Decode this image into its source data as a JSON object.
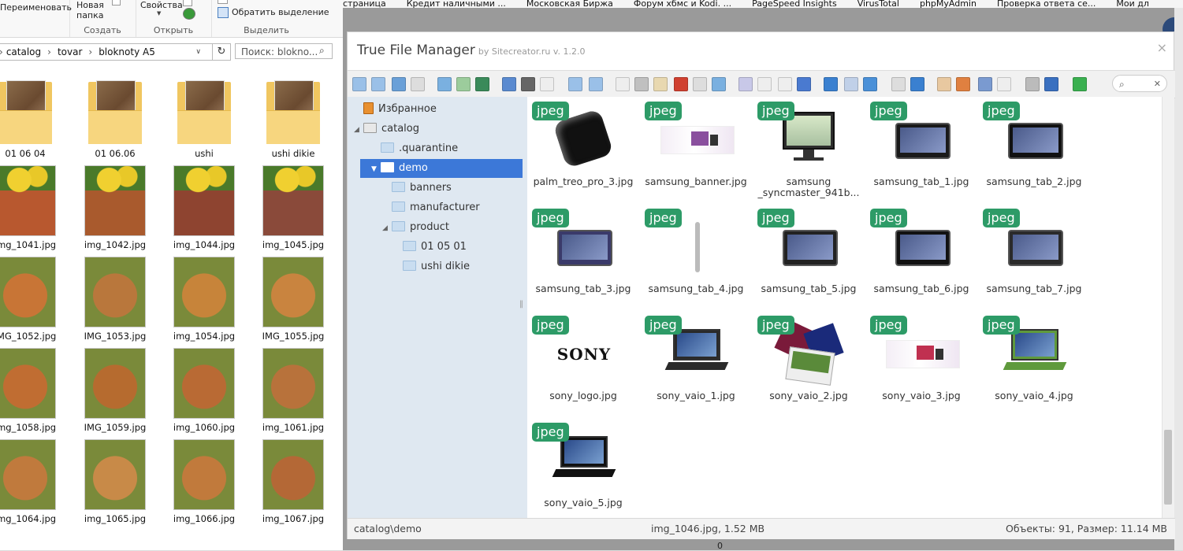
{
  "explorer": {
    "ribbon": {
      "rename": "Переименовать",
      "new_folder": "Новая папка",
      "group_create": "Создать",
      "properties": "Свойства",
      "group_open": "Открыть",
      "invert_selection": "Обратить выделение",
      "group_select": "Выделить"
    },
    "path": [
      "catalog",
      "tovar",
      "bloknoty A5"
    ],
    "search_placeholder": "Поиск: blokno...",
    "folders": [
      {
        "name": "01 06 04"
      },
      {
        "name": "01 06.06"
      },
      {
        "name": "ushi"
      },
      {
        "name": "ushi dikie"
      }
    ],
    "files": [
      {
        "name": "img_1041.jpg",
        "tone": "#b8582f"
      },
      {
        "name": "img_1042.jpg",
        "tone": "#a95a2d"
      },
      {
        "name": "img_1044.jpg",
        "tone": "#8e4430"
      },
      {
        "name": "img_1045.jpg",
        "tone": "#8a4a3a"
      },
      {
        "name": "IMG_1052.jpg",
        "tone": "#c87536"
      },
      {
        "name": "IMG_1053.jpg",
        "tone": "#b9773c"
      },
      {
        "name": "img_1054.jpg",
        "tone": "#c7843a"
      },
      {
        "name": "IMG_1055.jpg",
        "tone": "#c9843f"
      },
      {
        "name": "img_1058.jpg",
        "tone": "#c06d32"
      },
      {
        "name": "IMG_1059.jpg",
        "tone": "#b66b2f"
      },
      {
        "name": "img_1060.jpg",
        "tone": "#b96a34"
      },
      {
        "name": "img_1061.jpg",
        "tone": "#b8723b"
      },
      {
        "name": "img_1064.jpg",
        "tone": "#c07a3d"
      },
      {
        "name": "img_1065.jpg",
        "tone": "#c88a48"
      },
      {
        "name": "img_1066.jpg",
        "tone": "#c17a3c"
      },
      {
        "name": "img_1067.jpg",
        "tone": "#b46836"
      }
    ]
  },
  "bookmarks": [
    "страница",
    "Кредит наличными ...",
    "Московская Биржа",
    "Форум хбмс и Kodi. ...",
    "PageSpeed Insights",
    "VirusTotal",
    "phpMyAdmin",
    "Проверка ответа се...",
    "Мои дл"
  ],
  "tfm": {
    "title": "True File Manager",
    "subtitle": "by Sitecreator.ru v. 1.2.0",
    "close": "×",
    "tree": [
      {
        "label": "Избранное",
        "level": 0,
        "arrow": "",
        "kind": "fav"
      },
      {
        "label": "catalog",
        "level": 0,
        "arrow": "◢",
        "kind": "drive"
      },
      {
        "label": ".quarantine",
        "level": 1,
        "arrow": "",
        "kind": "folder"
      },
      {
        "label": "demo",
        "level": 1,
        "arrow": "▼",
        "kind": "folder"
      },
      {
        "label": "banners",
        "level": 2,
        "arrow": "",
        "kind": "folder"
      },
      {
        "label": "manufacturer",
        "level": 2,
        "arrow": "",
        "kind": "folder"
      },
      {
        "label": "product",
        "level": 2,
        "arrow": "◢",
        "kind": "folder"
      },
      {
        "label": "01 05 01",
        "level": 3,
        "arrow": "",
        "kind": "folder"
      },
      {
        "label": "ushi dikie",
        "level": 3,
        "arrow": "",
        "kind": "folder"
      }
    ],
    "badge_label": "jpeg",
    "files": [
      {
        "name": "palm_treo_pro_3.jpg",
        "kind": "phone",
        "color": "#111111"
      },
      {
        "name": "samsung_banner.jpg",
        "kind": "banner",
        "color": "#8a4f9e"
      },
      {
        "name": "samsung _syncmaster_941b...",
        "kind": "monitor",
        "color": "#2d2d2d"
      },
      {
        "name": "samsung_tab_1.jpg",
        "kind": "tablet",
        "color": "#1a1a1a"
      },
      {
        "name": "samsung_tab_2.jpg",
        "kind": "tablet",
        "color": "#111111"
      },
      {
        "name": "samsung_tab_3.jpg",
        "kind": "tablet",
        "color": "#3a3a6a"
      },
      {
        "name": "samsung_tab_4.jpg",
        "kind": "slim",
        "color": "#bbbbbb"
      },
      {
        "name": "samsung_tab_5.jpg",
        "kind": "tablet",
        "color": "#222222"
      },
      {
        "name": "samsung_tab_6.jpg",
        "kind": "tablet",
        "color": "#111111"
      },
      {
        "name": "samsung_tab_7.jpg",
        "kind": "tablet",
        "color": "#2a2a2a"
      },
      {
        "name": "sony_logo.jpg",
        "kind": "logo",
        "color": "#111111",
        "logo_text": "SONY"
      },
      {
        "name": "sony_vaio_1.jpg",
        "kind": "laptop",
        "color": "#2a2a2a"
      },
      {
        "name": "sony_vaio_2.jpg",
        "kind": "laptops",
        "color": "#7a1a3a"
      },
      {
        "name": "sony_vaio_3.jpg",
        "kind": "banner",
        "color": "#c03050"
      },
      {
        "name": "sony_vaio_4.jpg",
        "kind": "laptop",
        "color": "#5f9a3c"
      },
      {
        "name": "sony_vaio_5.jpg",
        "kind": "laptop",
        "color": "#111111"
      }
    ],
    "status": {
      "path": "catalog\\demo",
      "selected": "img_1046.jpg, 1.52 MB",
      "summary": "Объекты: 91, Размер: 11.14 MB"
    },
    "search_value": "",
    "toolbar_icons": [
      "back-icon",
      "forward-icon",
      "up-icon",
      "home-icon",
      "download-icon",
      "new-file-icon",
      "save-icon",
      "open-icon",
      "save-as-icon",
      "select-icon",
      "undo-icon",
      "redo-icon",
      "copy-icon",
      "cut-icon",
      "paste-icon",
      "delete-icon",
      "empty-icon",
      "resize-icon",
      "duplicate-icon",
      "select-all-icon",
      "edit-icon",
      "upload-icon",
      "grid-large-icon",
      "grid-small-icon",
      "grid-medium-icon",
      "preview-icon",
      "info-icon",
      "archive-icon",
      "extract-icon",
      "list-view-icon",
      "details-icon",
      "settings-icon",
      "help-icon",
      "fullscreen-icon"
    ]
  },
  "bg_page": {
    "zero": "0"
  }
}
